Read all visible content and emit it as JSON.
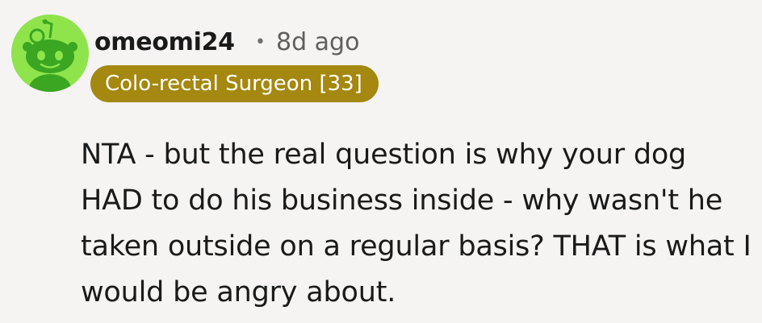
{
  "comment": {
    "username": "omeomi24",
    "separator": "•",
    "age": "8d ago",
    "flair": "Colo-rectal Surgeon [33]",
    "body": "NTA - but the real question is why your dog HAD to do his business inside - why wasn't he taken outside on a regular basis? THAT is what I would be angry about."
  },
  "colors": {
    "background": "#f5f4f3",
    "avatar_bg": "#8fe44c",
    "avatar_figure": "#3aa622",
    "flair_bg": "#a4880f",
    "flair_text": "#ffffff",
    "text": "#1a1a1b",
    "meta_text": "#5f5f5f"
  },
  "icons": {
    "avatar": "snoo-avatar-icon"
  }
}
